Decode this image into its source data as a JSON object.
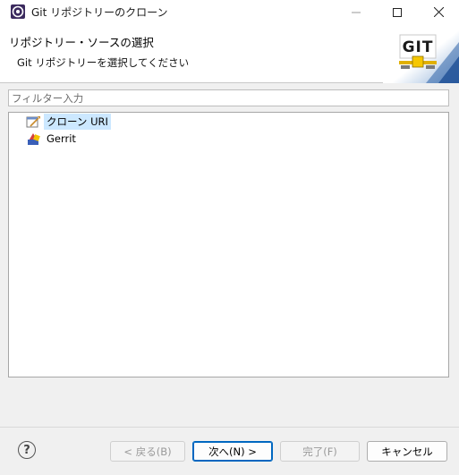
{
  "window": {
    "title": "Git リポジトリーのクローン",
    "controls": {
      "minimize": "—",
      "maximize": "☐",
      "close": "✕"
    }
  },
  "header": {
    "title": "リポジトリー・ソースの選択",
    "message": "Git リポジトリーを選択してください",
    "banner_text": "GIT"
  },
  "filter": {
    "placeholder": "フィルター入力",
    "value": ""
  },
  "tree": {
    "items": [
      {
        "label": "クローン URI",
        "icon": "clone-uri-icon",
        "selected": true
      },
      {
        "label": "Gerrit",
        "icon": "gerrit-icon",
        "selected": false
      }
    ]
  },
  "footer": {
    "help": "?",
    "back": "< 戻る(B)",
    "next": "次へ(N) >",
    "finish": "完了(F)",
    "cancel": "キャンセル"
  },
  "colors": {
    "selection": "#cce8ff",
    "default_button_border": "#0067c0",
    "banner_gradient": "#2d62a8"
  }
}
